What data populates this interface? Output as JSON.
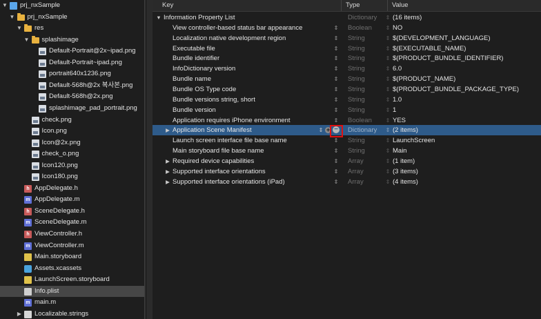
{
  "navigator": {
    "items": [
      {
        "label": "prj_nxSample",
        "icon": "project-file-icon",
        "kind": "proj",
        "depth": 0,
        "disclosure": "open"
      },
      {
        "label": "prj_nxSample",
        "icon": "folder-icon",
        "kind": "folder",
        "depth": 1,
        "disclosure": "open"
      },
      {
        "label": "res",
        "icon": "folder-icon",
        "kind": "folder",
        "depth": 2,
        "disclosure": "open"
      },
      {
        "label": "splashimage",
        "icon": "folder-icon",
        "kind": "folder",
        "depth": 3,
        "disclosure": "open"
      },
      {
        "label": "Default-Portrait@2x~ipad.png",
        "icon": "image-file-icon",
        "kind": "png",
        "depth": 4
      },
      {
        "label": "Default-Portrait~ipad.png",
        "icon": "image-file-icon",
        "kind": "png",
        "depth": 4
      },
      {
        "label": "portrait640x1236.png",
        "icon": "image-file-icon",
        "kind": "png",
        "depth": 4
      },
      {
        "label": "Default-568h@2x 복사본.png",
        "icon": "image-file-icon",
        "kind": "png",
        "depth": 4
      },
      {
        "label": "Default-568h@2x.png",
        "icon": "image-file-icon",
        "kind": "png",
        "depth": 4
      },
      {
        "label": "splashimage_pad_portrait.png",
        "icon": "image-file-icon",
        "kind": "png",
        "depth": 4
      },
      {
        "label": "check.png",
        "icon": "image-file-icon",
        "kind": "png",
        "depth": 3
      },
      {
        "label": "Icon.png",
        "icon": "image-file-icon",
        "kind": "png",
        "depth": 3
      },
      {
        "label": "Icon@2x.png",
        "icon": "image-file-icon",
        "kind": "png",
        "depth": 3
      },
      {
        "label": "check_o.png",
        "icon": "image-file-icon",
        "kind": "png",
        "depth": 3
      },
      {
        "label": "Icon120.png",
        "icon": "image-file-icon",
        "kind": "png",
        "depth": 3
      },
      {
        "label": "Icon180.png",
        "icon": "image-file-icon",
        "kind": "png",
        "depth": 3
      },
      {
        "label": "AppDelegate.h",
        "icon": "header-file-icon",
        "kind": "h",
        "depth": 2
      },
      {
        "label": "AppDelegate.m",
        "icon": "objc-file-icon",
        "kind": "m",
        "depth": 2
      },
      {
        "label": "SceneDelegate.h",
        "icon": "header-file-icon",
        "kind": "h",
        "depth": 2
      },
      {
        "label": "SceneDelegate.m",
        "icon": "objc-file-icon",
        "kind": "m",
        "depth": 2
      },
      {
        "label": "ViewController.h",
        "icon": "header-file-icon",
        "kind": "h",
        "depth": 2
      },
      {
        "label": "ViewController.m",
        "icon": "objc-file-icon",
        "kind": "m",
        "depth": 2
      },
      {
        "label": "Main.storyboard",
        "icon": "storyboard-file-icon",
        "kind": "sb",
        "depth": 2
      },
      {
        "label": "Assets.xcassets",
        "icon": "asset-catalog-icon",
        "kind": "assets",
        "depth": 2
      },
      {
        "label": "LaunchScreen.storyboard",
        "icon": "storyboard-file-icon",
        "kind": "sb",
        "depth": 2
      },
      {
        "label": "Info.plist",
        "icon": "plist-file-icon",
        "kind": "plist",
        "depth": 2,
        "selected": true
      },
      {
        "label": "main.m",
        "icon": "objc-file-icon",
        "kind": "m",
        "depth": 2
      },
      {
        "label": "Localizable.strings",
        "icon": "strings-file-icon",
        "kind": "strings",
        "depth": 2,
        "disclosure": "closed"
      }
    ],
    "type_letters": {
      "h": "h",
      "m": "m"
    }
  },
  "editor": {
    "columns": {
      "key": "Key",
      "type": "Type",
      "value": "Value"
    },
    "rows": [
      {
        "key": "Information Property List",
        "type": "Dictionary",
        "value": "(16 items)",
        "indent": 0,
        "disclosure": "open"
      },
      {
        "key": "View controller-based status bar appearance",
        "type": "Boolean",
        "value": "NO",
        "indent": 1
      },
      {
        "key": "Localization native development region",
        "type": "String",
        "value": "$(DEVELOPMENT_LANGUAGE)",
        "indent": 1
      },
      {
        "key": "Executable file",
        "type": "String",
        "value": "$(EXECUTABLE_NAME)",
        "indent": 1
      },
      {
        "key": "Bundle identifier",
        "type": "String",
        "value": "$(PRODUCT_BUNDLE_IDENTIFIER)",
        "indent": 1
      },
      {
        "key": "InfoDictionary version",
        "type": "String",
        "value": "6.0",
        "indent": 1
      },
      {
        "key": "Bundle name",
        "type": "String",
        "value": "$(PRODUCT_NAME)",
        "indent": 1
      },
      {
        "key": "Bundle OS Type code",
        "type": "String",
        "value": "$(PRODUCT_BUNDLE_PACKAGE_TYPE)",
        "indent": 1
      },
      {
        "key": "Bundle versions string, short",
        "type": "String",
        "value": "1.0",
        "indent": 1
      },
      {
        "key": "Bundle version",
        "type": "String",
        "value": "1",
        "indent": 1
      },
      {
        "key": "Application requires iPhone environment",
        "type": "Boolean",
        "value": "YES",
        "indent": 1
      },
      {
        "key": "Application Scene Manifest",
        "type": "Dictionary",
        "value": "(2 items)",
        "indent": 1,
        "disclosure": "closed",
        "selected": true
      },
      {
        "key": "Launch screen interface file base name",
        "type": "String",
        "value": "LaunchScreen",
        "indent": 1
      },
      {
        "key": "Main storyboard file base name",
        "type": "String",
        "value": "Main",
        "indent": 1
      },
      {
        "key": "Required device capabilities",
        "type": "Array",
        "value": "(1 item)",
        "indent": 1,
        "disclosure": "closed"
      },
      {
        "key": "Supported interface orientations",
        "type": "Array",
        "value": "(3 items)",
        "indent": 1,
        "disclosure": "closed"
      },
      {
        "key": "Supported interface orientations (iPad)",
        "type": "Array",
        "value": "(4 items)",
        "indent": 1,
        "disclosure": "closed"
      }
    ],
    "selected_row_buttons": {
      "add": "+",
      "remove": "−"
    },
    "colors": {
      "selection": "#2e5b8a",
      "highlight_box": "#e01010"
    }
  }
}
